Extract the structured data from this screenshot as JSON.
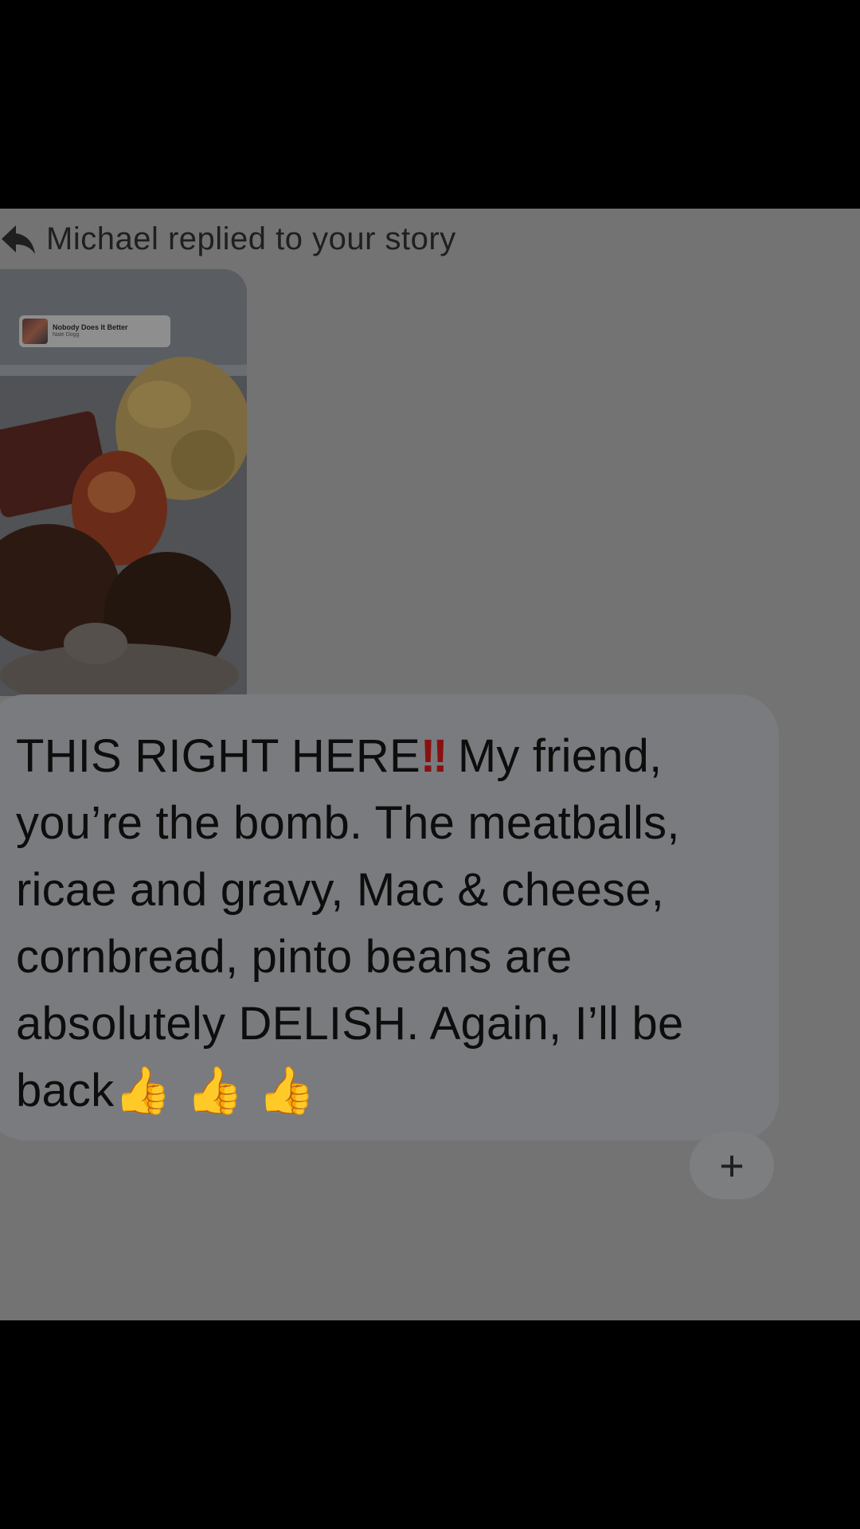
{
  "reply": {
    "header_text": "Michael replied to your story",
    "icon": "reply-arrow-icon"
  },
  "story": {
    "song_title": "Nobody Does It Better",
    "song_artist": "Nate Dogg"
  },
  "message": {
    "text_before": "THIS RIGHT HERE",
    "emphasis": "!!",
    "text_after": " My friend, you’re the bomb. The meatballs, ricae and gravy, Mac & cheese, cornbread, pinto beans are absolutely DELISH. Again, I’ll be back",
    "thumbs": "👍👍👍"
  },
  "reaction_button": {
    "label": "+"
  },
  "colors": {
    "page_background": "#000000",
    "panel": "#737373",
    "bubble": "#7a7b7e",
    "emphasis": "#8a1010"
  }
}
